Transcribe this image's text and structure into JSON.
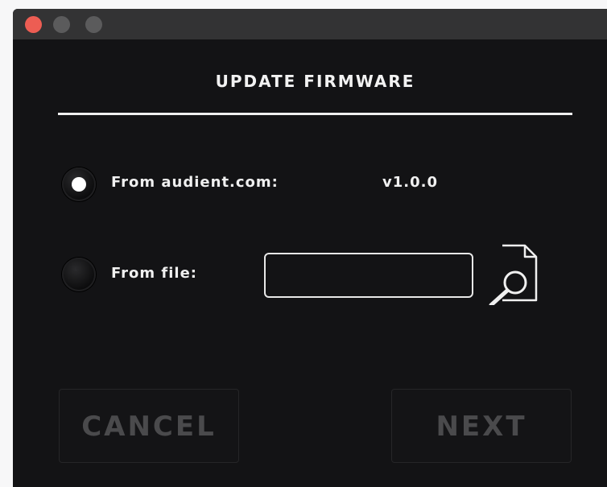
{
  "window": {
    "controls": [
      "close",
      "minimize",
      "maximize"
    ]
  },
  "dialog": {
    "title": "UPDATE FIRMWARE",
    "options": [
      {
        "label": "From audient.com:",
        "value": "v1.0.0",
        "selected": true
      },
      {
        "label": "From file:",
        "selected": false
      }
    ],
    "file_path": {
      "value": "",
      "placeholder": ""
    },
    "browse_icon": "file-search-icon",
    "buttons": {
      "cancel": "CANCEL",
      "next": "NEXT"
    }
  },
  "colors": {
    "background": "#131315",
    "titlebar": "#333334",
    "close": "#ed5d53",
    "text": "#f0f0f0",
    "disabled_text": "#4a4a4c"
  }
}
